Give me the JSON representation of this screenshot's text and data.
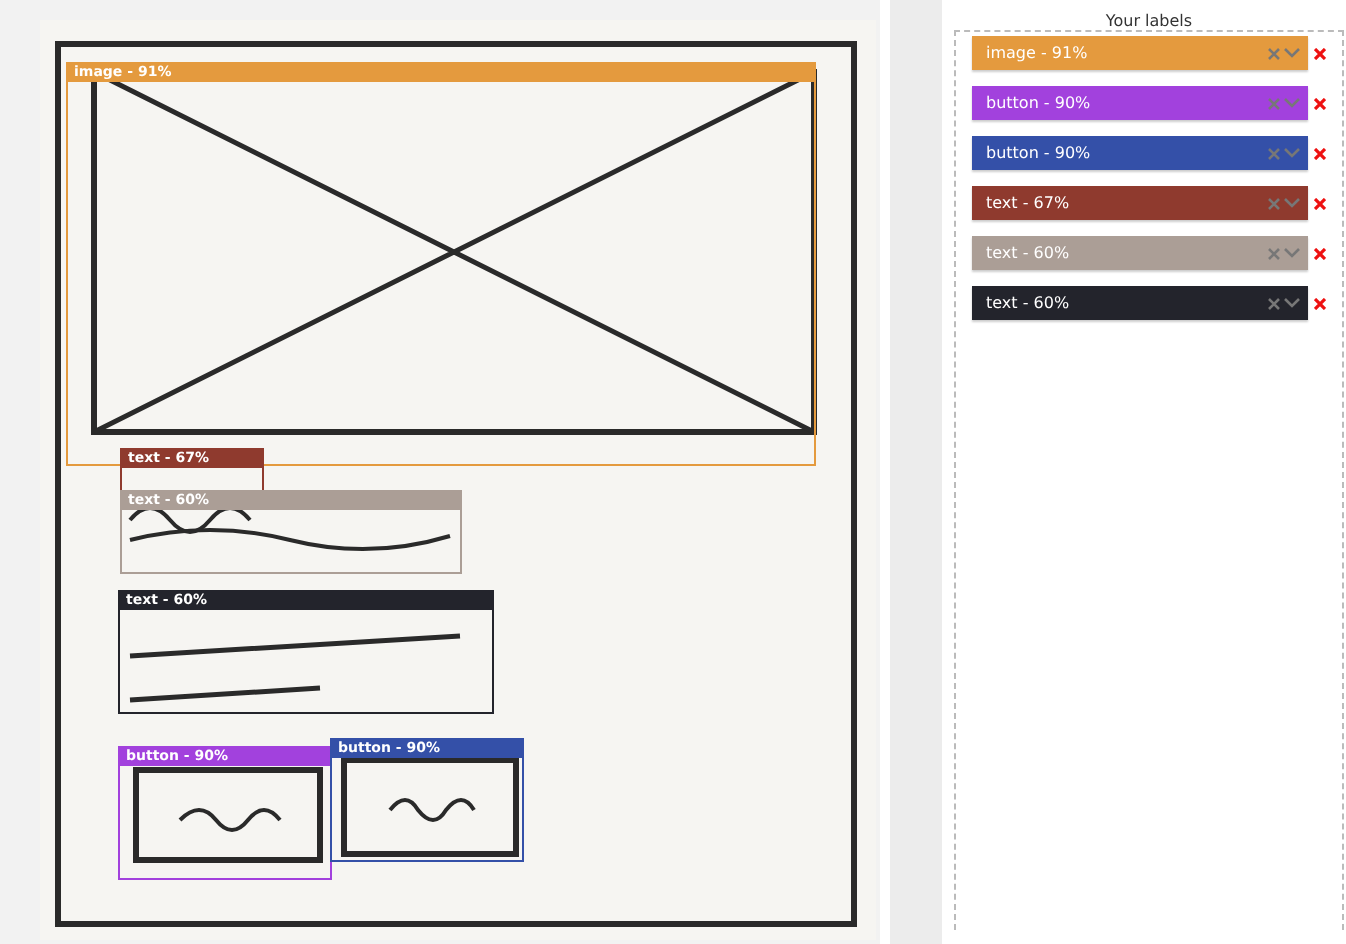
{
  "detections": [
    {
      "label": "image - 91%",
      "color": "#e49a3e"
    },
    {
      "label": "text - 67%",
      "color": "#8f3a2e"
    },
    {
      "label": "text - 60%",
      "color": "#ab9e96"
    },
    {
      "label": "text - 60%",
      "color": "#23242c"
    },
    {
      "label": "button - 90%",
      "color": "#a241dd"
    },
    {
      "label": "button - 90%",
      "color": "#3450a8"
    }
  ],
  "labels_panel": {
    "title": "Your labels",
    "items": [
      {
        "label": "image - 91%",
        "color": "#e49a3e"
      },
      {
        "label": "button - 90%",
        "color": "#a241dd"
      },
      {
        "label": "button - 90%",
        "color": "#3450a8"
      },
      {
        "label": "text - 67%",
        "color": "#8f3a2e"
      },
      {
        "label": "text - 60%",
        "color": "#ab9e96"
      },
      {
        "label": "text - 60%",
        "color": "#23242c"
      }
    ]
  }
}
